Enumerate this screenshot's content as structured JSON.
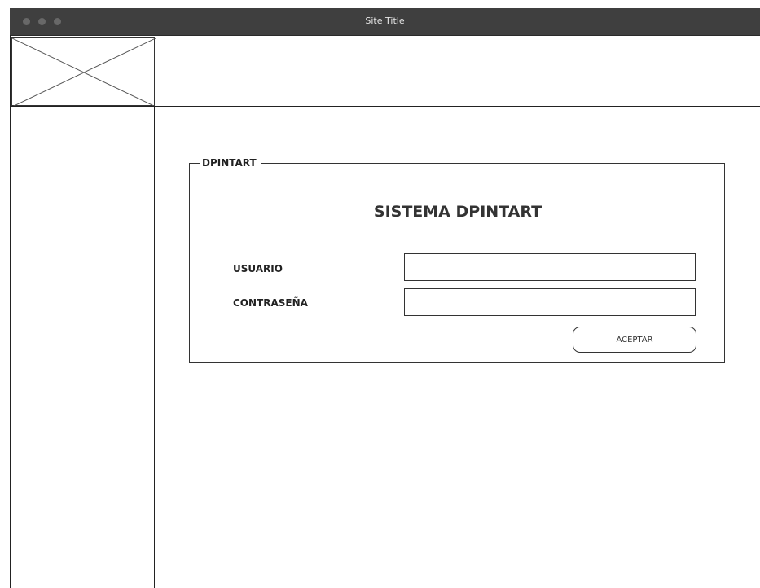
{
  "window": {
    "title": "Site Title"
  },
  "header": {
    "logo_icon": "image-placeholder-icon"
  },
  "login": {
    "group_label": "DPINTART",
    "heading": "SISTEMA DPINTART",
    "username_label": "USUARIO",
    "username_value": "",
    "password_label": "CONTRASEÑA",
    "password_value": "",
    "submit_label": "ACEPTAR"
  },
  "colors": {
    "titlebar": "#3f3f3f",
    "traffic_lights": "#686868",
    "stroke": "#333333"
  }
}
